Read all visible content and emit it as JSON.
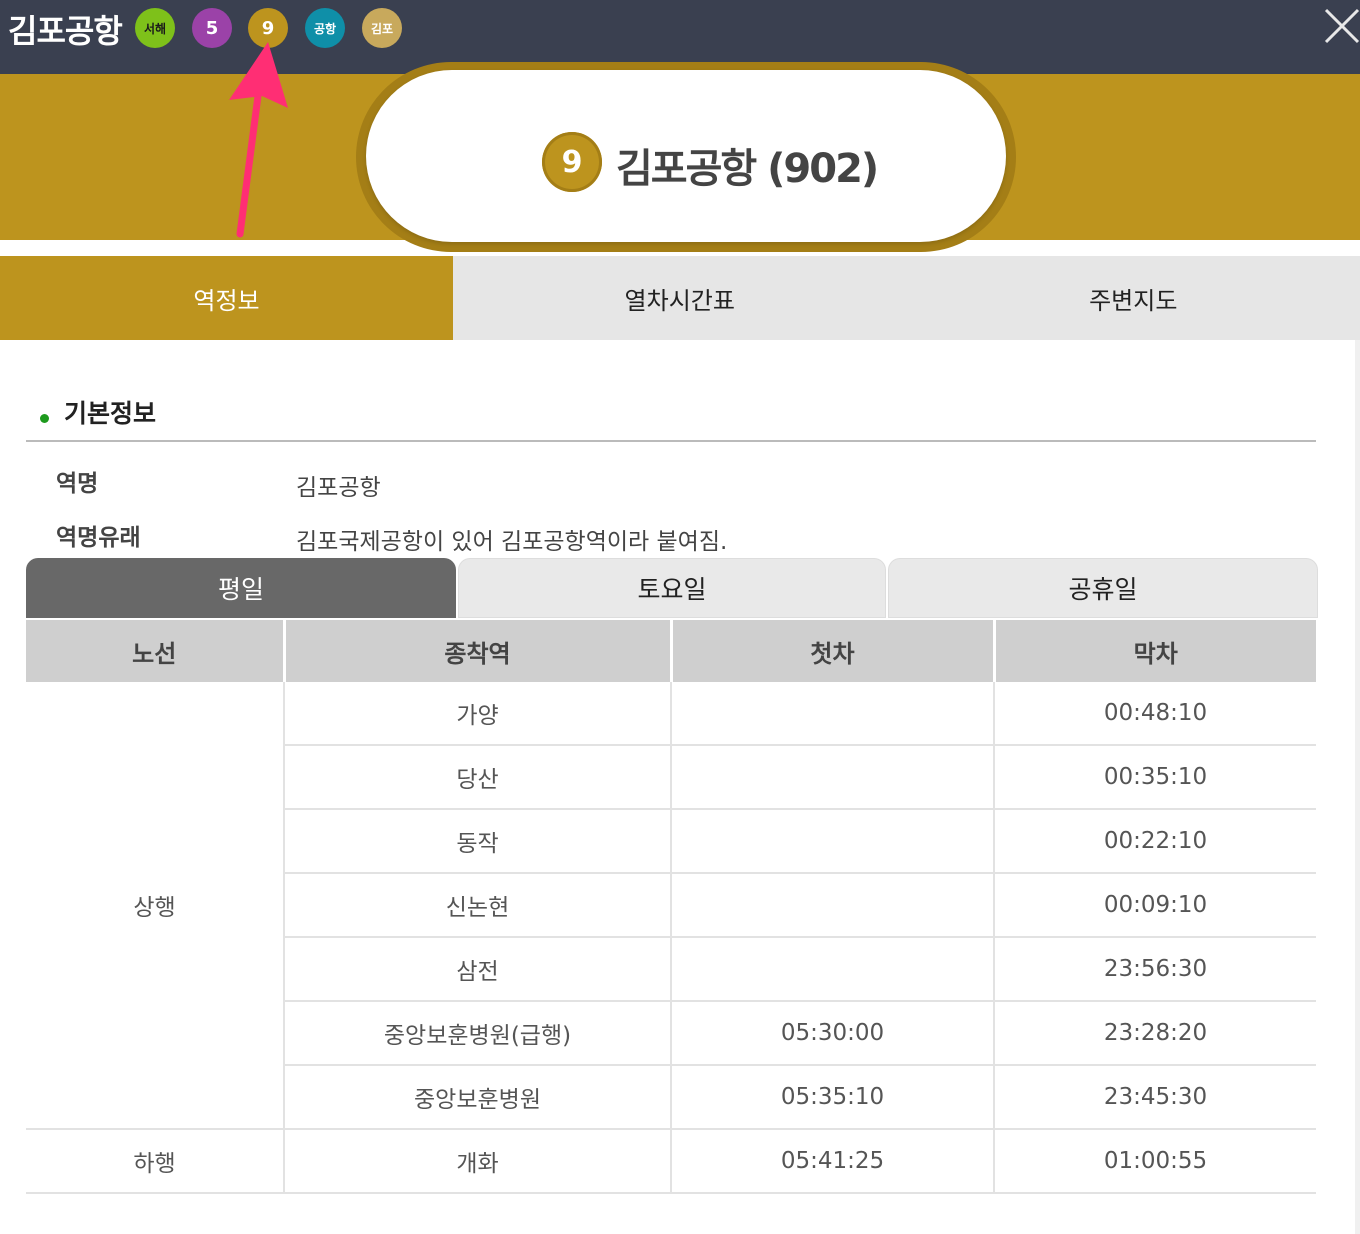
{
  "header": {
    "station_title": "김포공항",
    "line_badges": [
      {
        "label": "서해",
        "bg": "#7ec11a",
        "fg": "#1a1a1a"
      },
      {
        "label": "5",
        "bg": "#9b42a8",
        "fg": "#ffffff"
      },
      {
        "label": "9",
        "bg": "#bd941e",
        "fg": "#ffffff"
      },
      {
        "label": "공항",
        "bg": "#0f8fa8",
        "fg": "#ffffff"
      },
      {
        "label": "김포",
        "bg": "#c8a95c",
        "fg": "#ffffff"
      }
    ],
    "close_icon": "close-icon"
  },
  "station_pill": {
    "line_number": "9",
    "name": "김포공항 (902)"
  },
  "main_tabs": [
    {
      "label": "역정보",
      "active": true
    },
    {
      "label": "열차시간표",
      "active": false
    },
    {
      "label": "주변지도",
      "active": false
    }
  ],
  "basic_info": {
    "title": "기본정보",
    "station_name_key": "역명",
    "station_name_value": "김포공항",
    "origin_key": "역명유래",
    "origin_value": "김포국제공항이 있어 김포공항역이라 붙여짐."
  },
  "day_tabs": [
    {
      "label": "평일",
      "active": true
    },
    {
      "label": "토요일",
      "active": false
    },
    {
      "label": "공휴일",
      "active": false
    }
  ],
  "timetable": {
    "headers": [
      "노선",
      "종착역",
      "첫차",
      "막차"
    ],
    "groups": [
      {
        "direction": "상행",
        "rows": [
          {
            "terminal": "가양",
            "first": "",
            "last": "00:48:10"
          },
          {
            "terminal": "당산",
            "first": "",
            "last": "00:35:10"
          },
          {
            "terminal": "동작",
            "first": "",
            "last": "00:22:10"
          },
          {
            "terminal": "신논현",
            "first": "",
            "last": "00:09:10"
          },
          {
            "terminal": "삼전",
            "first": "",
            "last": "23:56:30"
          },
          {
            "terminal": "중앙보훈병원(급행)",
            "first": "05:30:00",
            "last": "23:28:20"
          },
          {
            "terminal": "중앙보훈병원",
            "first": "05:35:10",
            "last": "23:45:30"
          }
        ]
      },
      {
        "direction": "하행",
        "rows": [
          {
            "terminal": "개화",
            "first": "05:41:25",
            "last": "01:00:55"
          }
        ]
      }
    ]
  },
  "colors": {
    "line9_gold": "#bd941e",
    "header_bg": "#3a4050",
    "annotation_arrow": "#ff2e74"
  }
}
